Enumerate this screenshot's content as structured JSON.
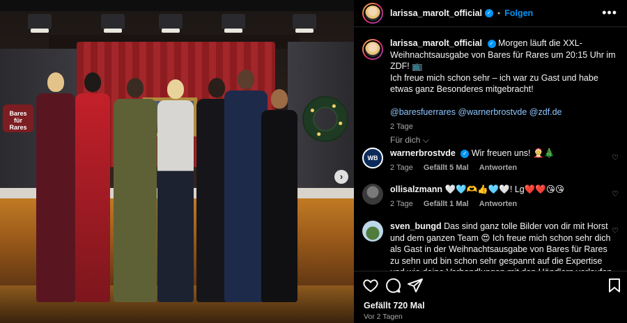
{
  "photo": {
    "sign_text": "Bares für Rares",
    "next_glyph": "›"
  },
  "header": {
    "username": "larissa_marolt_official",
    "separator": "•",
    "follow_label": "Folgen",
    "more_glyph": "•••"
  },
  "caption": {
    "username": "larissa_marolt_official",
    "text_line1": "Morgen läuft die XXL-Weihnachtsausgabe von Bares für Rares um 20:15 Uhr im ZDF! 📺",
    "text_line2": "Ich freue mich schon sehr – ich war zu Gast und habe etwas ganz Besonderes mitgebracht!",
    "mentions": "@baresfuerrares @warnerbrostvde @zdf.de",
    "time": "2 Tage"
  },
  "see_all": "Für dich ⌵",
  "comments": [
    {
      "username": "warnerbrostvde",
      "avatar_text": "WB",
      "text": "Wir freuen uns! 🤶🎄",
      "time": "2 Tage",
      "likes": "Gefällt 5 Mal",
      "reply": "Antworten"
    },
    {
      "username": "ollisalzmann",
      "text": "🤍🩵🫶👍🩵🤍! Lg❤️❤️😘😘",
      "time": "2 Tage",
      "likes": "Gefällt 1 Mal",
      "reply": "Antworten"
    },
    {
      "username": "sven_bungd",
      "text": "Das sind ganz tolle Bilder von dir mit Horst und dem ganzen Team 😍 Ich freue mich schon sehr dich als Gast in der Weihnachtsausgabe von Bares für Rares zu sehn und bin schon sehr gespannt auf die Expertise und wie deine Verhandlungen mit den Händlern verlaufen 😊 🍀 😎"
    }
  ],
  "footer": {
    "likes": "Gefällt 720 Mal",
    "date": "Vor 2 Tagen"
  },
  "colors": {
    "accent": "#0095f6",
    "muted": "#a8a8a8",
    "background": "#000000"
  }
}
